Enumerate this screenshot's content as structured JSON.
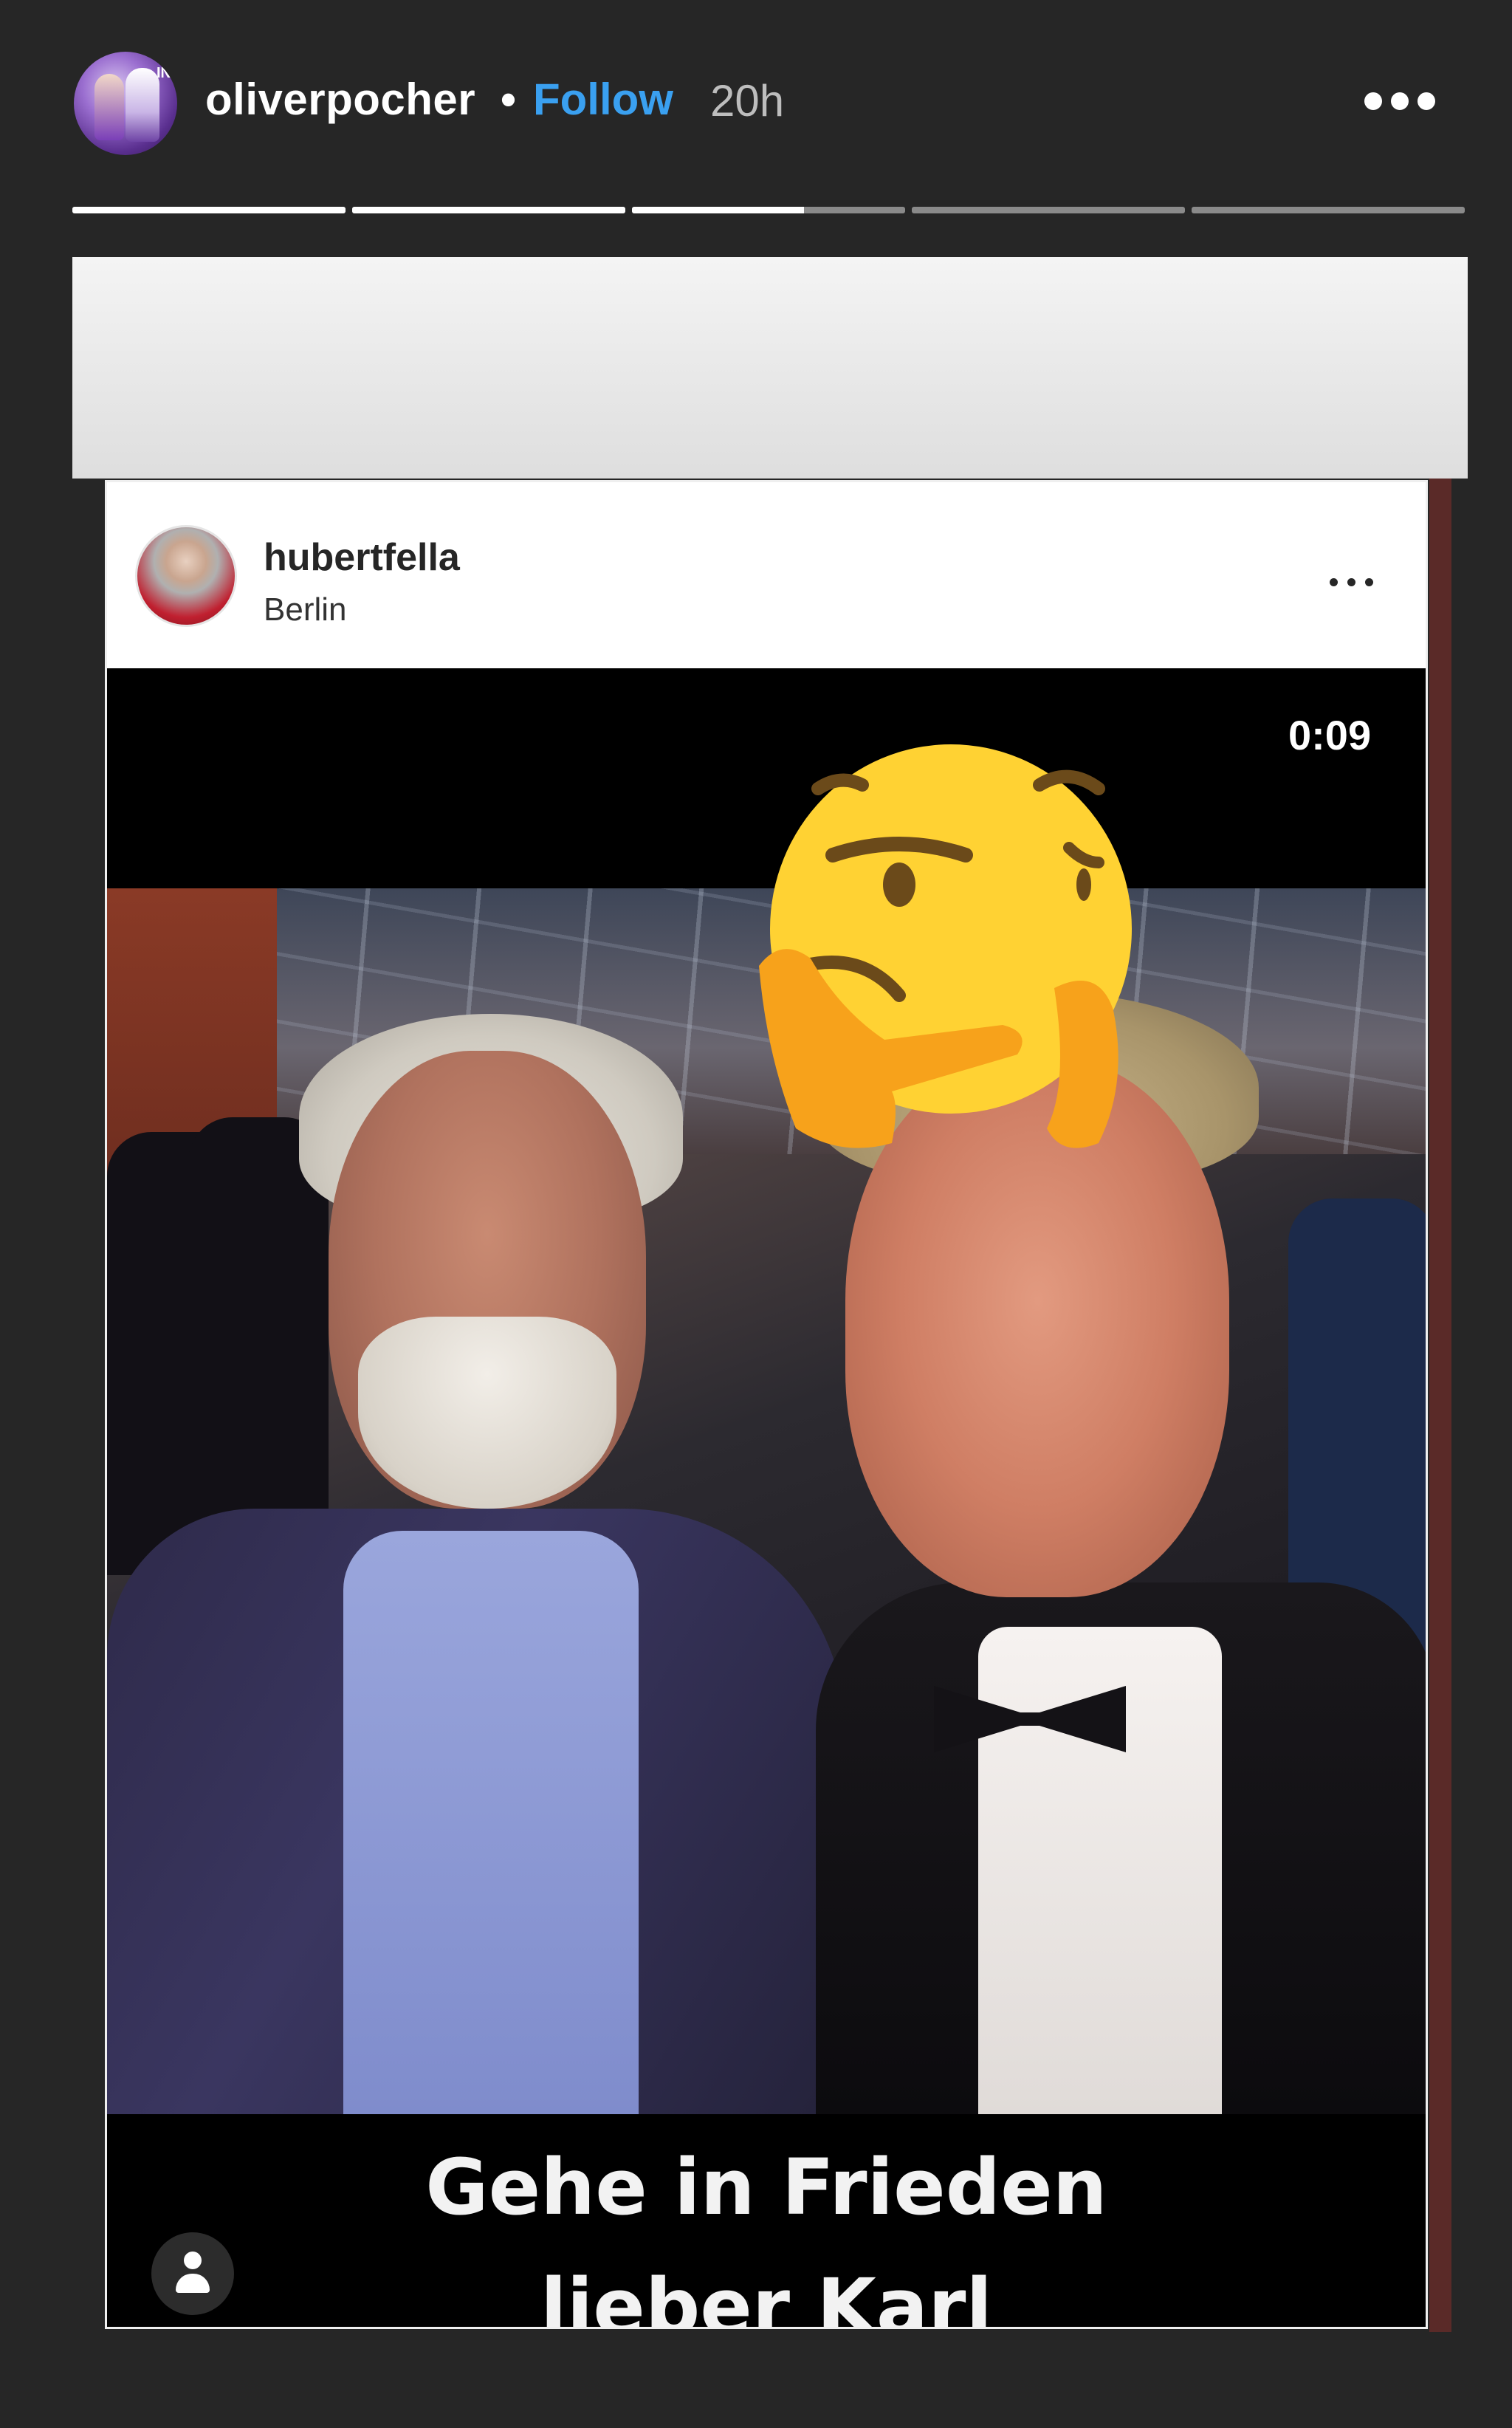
{
  "story": {
    "username": "oliverpocher",
    "separator": "•",
    "follow_label": "Follow",
    "time_ago": "20h",
    "avatar_badge": "IN",
    "segments": [
      {
        "progress": 1.0
      },
      {
        "progress": 1.0
      },
      {
        "progress": 0.63
      },
      {
        "progress": 0.0
      },
      {
        "progress": 0.0
      }
    ],
    "icons": {
      "more": "more-horizontal-icon",
      "sticker": "thinking-face-emoji",
      "user_tag": "user-tag-icon"
    }
  },
  "post": {
    "username": "hubertfella",
    "location": "Berlin",
    "video_time": "0:09",
    "caption_line1": "Gehe in Frieden",
    "caption_line2": "lieber Karl"
  },
  "colors": {
    "background": "#262626",
    "follow": "#3aa0f0",
    "emoji_yellow": "#ffd233",
    "emoji_hand": "#f7a21b"
  }
}
